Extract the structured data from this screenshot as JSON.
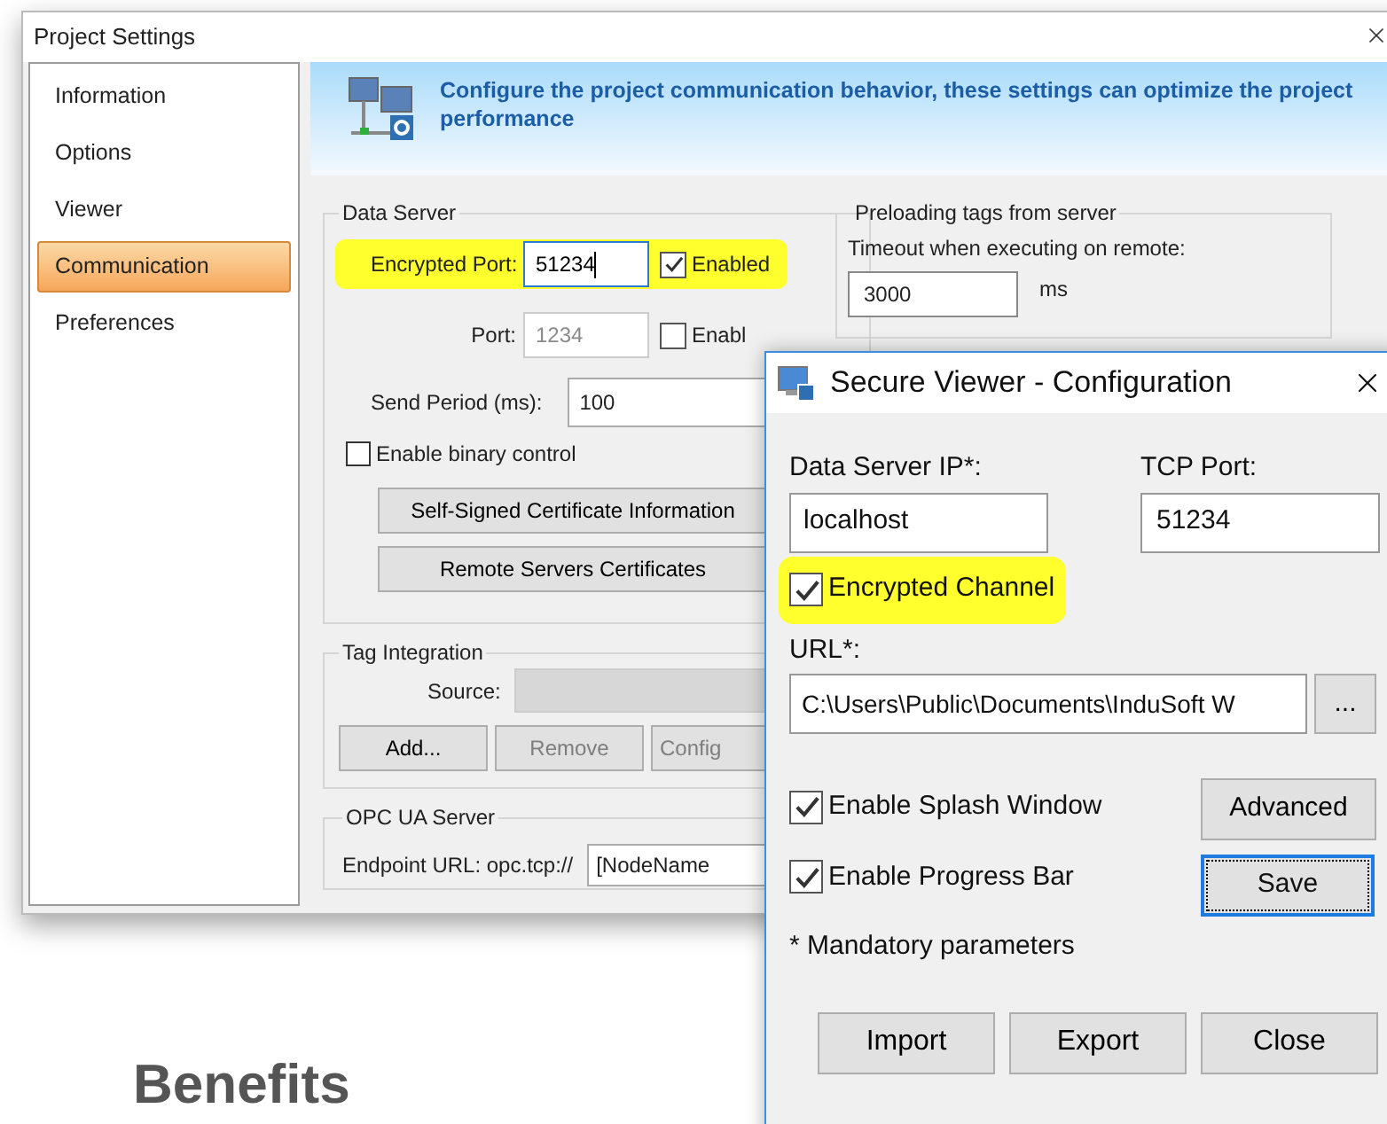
{
  "project_settings": {
    "title": "Project Settings",
    "sidebar": {
      "items": [
        {
          "label": "Information",
          "selected": false
        },
        {
          "label": "Options",
          "selected": false
        },
        {
          "label": "Viewer",
          "selected": false
        },
        {
          "label": "Communication",
          "selected": true
        },
        {
          "label": "Preferences",
          "selected": false
        }
      ]
    },
    "header": {
      "text": "Configure the project communication behavior, these settings can optimize the project performance"
    },
    "data_server": {
      "title": "Data Server",
      "encrypted_port": {
        "label": "Encrypted Port:",
        "value": "51234",
        "highlighted": true,
        "checkbox": {
          "label": "Enabled",
          "checked": true
        }
      },
      "port": {
        "label": "Port:",
        "value": "1234",
        "disabled": true,
        "highlighted": false,
        "checkbox": {
          "label": "Enabl",
          "checked": false
        }
      },
      "send_period": {
        "label": "Send Period (ms):",
        "value": "100"
      },
      "binary_control": {
        "label": "Enable binary control",
        "checked": false
      },
      "buttons": [
        "Self-Signed Certificate Information",
        "Remote Servers Certificates"
      ]
    },
    "tag_integration": {
      "title": "Tag Integration",
      "source_label": "Source:",
      "buttons": [
        {
          "label": "Add...",
          "disabled": false
        },
        {
          "label": "Remove",
          "disabled": true
        },
        {
          "label": "Config",
          "disabled": true
        }
      ]
    },
    "opc_ua": {
      "title": "OPC UA Server",
      "endpoint_label": "Endpoint URL: opc.tcp://",
      "endpoint_value": "[NodeName"
    },
    "preloading": {
      "title": "Preloading tags from server",
      "timeout_label": "Timeout when executing on remote:",
      "value": "3000",
      "unit": "ms"
    }
  },
  "dialog": {
    "title": "Secure Viewer - Configuration",
    "ip": {
      "label": "Data Server IP*:",
      "value": "localhost"
    },
    "tcp_port": {
      "label": "TCP Port:",
      "value": "51234"
    },
    "encrypted_channel": {
      "label": "Encrypted Channel",
      "checked": true,
      "highlighted": true
    },
    "url": {
      "label": "URL*:",
      "value": "C:\\Users\\Public\\Documents\\InduSoft W",
      "browse": "..."
    },
    "splash": {
      "label": "Enable Splash Window",
      "checked": true
    },
    "progress": {
      "label": "Enable Progress Bar",
      "checked": true
    },
    "advanced": "Advanced",
    "save": {
      "label": "Save",
      "focused": true
    },
    "note": "* Mandatory parameters",
    "buttons": [
      "Import",
      "Export",
      "Close"
    ]
  },
  "heading": "Benefits"
}
